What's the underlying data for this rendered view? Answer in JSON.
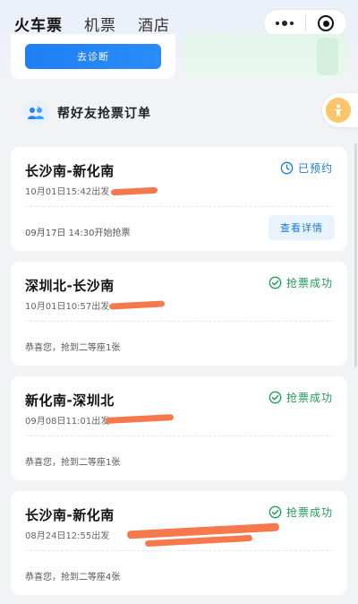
{
  "tabs": [
    {
      "label": "火车票",
      "active": true
    },
    {
      "label": "机票",
      "active": false
    },
    {
      "label": "酒店",
      "active": false
    }
  ],
  "capsule": {
    "more_icon": "more-dots-icon",
    "close_icon": "target-circle-icon"
  },
  "top_cards": {
    "diagnose_label": "去诊断"
  },
  "help_banner": {
    "label": "帮好友抢票订单"
  },
  "orders": [
    {
      "route": "长沙南-新化南",
      "depart": "10月01日15:42出发",
      "status": "已预约",
      "status_type": "booked",
      "bottom_text": "09月17日 14:30开始抢票",
      "action_label": "查看详情"
    },
    {
      "route": "深圳北-长沙南",
      "depart": "10月01日10:57出发",
      "status": "抢票成功",
      "status_type": "success",
      "bottom_text": "恭喜您，抢到二等座1张"
    },
    {
      "route": "新化南-深圳北",
      "depart": "09月08日11:01出发",
      "status": "抢票成功",
      "status_type": "success",
      "bottom_text": "恭喜您，抢到二等座1张"
    },
    {
      "route": "长沙南-新化南",
      "depart": "08月24日12:55出发",
      "status": "抢票成功",
      "status_type": "success",
      "bottom_text": "恭喜您，抢到二等座4张"
    }
  ],
  "colors": {
    "accent_blue": "#1f7ff4",
    "success_green": "#1f9d55",
    "booked_blue": "#1b7bd6",
    "redaction": "#f5794d"
  }
}
